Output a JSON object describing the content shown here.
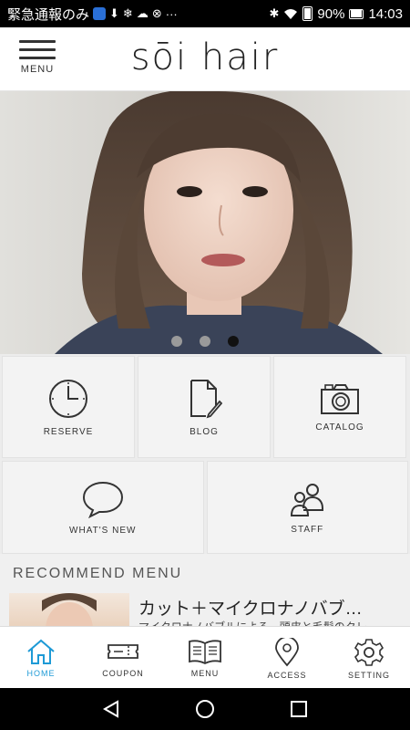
{
  "status_bar": {
    "left_text": "緊急通報のみ",
    "icons": [
      "shield-badge-icon",
      "download-icon",
      "snowflake-icon",
      "cloud-icon",
      "no-signal-icon",
      "more-icon"
    ],
    "more": "···",
    "battery": "90%",
    "time": "14:03"
  },
  "header": {
    "menu_label": "MENU",
    "logo": "sōi hair"
  },
  "hero": {
    "slide_count": 3,
    "active_slide": 3
  },
  "tiles": [
    {
      "label": "RESERVE",
      "icon": "clock-icon"
    },
    {
      "label": "BLOG",
      "icon": "document-edit-icon"
    },
    {
      "label": "CATALOG",
      "icon": "camera-icon"
    },
    {
      "label": "WHAT'S NEW",
      "icon": "speech-bubble-icon"
    },
    {
      "label": "STAFF",
      "icon": "people-icon"
    }
  ],
  "recommend": {
    "title": "RECOMMEND MENU",
    "items": [
      {
        "name": "カット＋マイクロナノバブ…",
        "description": "マイクロナノバブルによる、頭皮と毛髪のクレ…"
      }
    ]
  },
  "tabbar": [
    {
      "label": "HOME",
      "icon": "home-icon",
      "active": true
    },
    {
      "label": "COUPON",
      "icon": "ticket-icon",
      "active": false
    },
    {
      "label": "MENU",
      "icon": "book-icon",
      "active": false
    },
    {
      "label": "ACCESS",
      "icon": "map-pin-icon",
      "active": false
    },
    {
      "label": "SETTING",
      "icon": "gear-icon",
      "active": false
    }
  ],
  "colors": {
    "accent": "#1e9ad6",
    "text": "#333333",
    "tile_bg": "#f3f3f3"
  }
}
